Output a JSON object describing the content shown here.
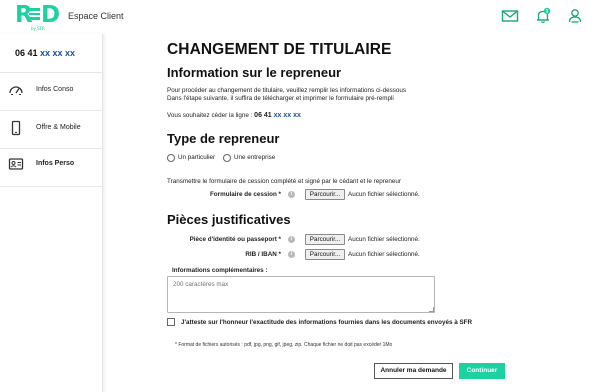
{
  "header": {
    "logo_text": "RED",
    "logo_sub": "by SFR",
    "espace_client": "Espace Client",
    "icons": [
      "mail-icon",
      "notifications-bell-icon",
      "user-account-icon"
    ],
    "notification_count": "1",
    "accent_color": "#1dd1a1"
  },
  "sidebar": {
    "phone_number_prefix": "06 41 ",
    "phone_number_masked": "xx xx xx",
    "items": [
      {
        "label": "Infos Conso",
        "icon": "gauge-icon",
        "active": false
      },
      {
        "label": "Offre & Mobile",
        "icon": "mobile-phone-icon",
        "active": false
      },
      {
        "label": "Infos Perso",
        "icon": "id-card-icon",
        "active": true
      }
    ]
  },
  "main": {
    "title": "CHANGEMENT DE TITULAIRE",
    "section_repreneur": {
      "heading": "Information sur le repreneur",
      "intro_line1": "Pour procéder au changement de titulaire, veuillez remplir les informations ci-dessous",
      "intro_line2": "Dans l'étape suivante, il suffira de télécharger et imprimer le formulaire pré-rempli",
      "cede_label": "Vous souhaitez céder la ligne : ",
      "line_prefix": "06 41 ",
      "line_masked": "xx xx xx"
    },
    "section_type": {
      "heading": "Type de repreneur",
      "option_particulier": "Un particulier",
      "option_entreprise": "Une entreprise"
    },
    "transmit_text": "Transmettre le formulaire de cession complété et signé par le cédant et le repreneur",
    "formulaire": {
      "label": "Formulaire de cession *",
      "browse": "Parcourir...",
      "status": "Aucun fichier sélectionné."
    },
    "section_pieces": {
      "heading": "Pièces justificatives",
      "identite": {
        "label": "Pièce d'identité ou passeport *",
        "browse": "Parcourir...",
        "status": "Aucun fichier sélectionné."
      },
      "rib": {
        "label": "RIB / IBAN *",
        "browse": "Parcourir...",
        "status": "Aucun fichier sélectionné."
      }
    },
    "complementary": {
      "label": "Informations complémentaires :",
      "placeholder": "200 caractères max"
    },
    "attest_text": "J'atteste sur l'honneur l'exactitude des informations fournies dans les documents envoyés à SFR",
    "note": "* Format de fichiers autorisés : pdf, jpg, png, gif, jpeg, zip. Chaque fichier ne doit pas excéder 1Mo",
    "buttons": {
      "cancel": "Annuler ma demande",
      "continue": "Continuer"
    }
  }
}
